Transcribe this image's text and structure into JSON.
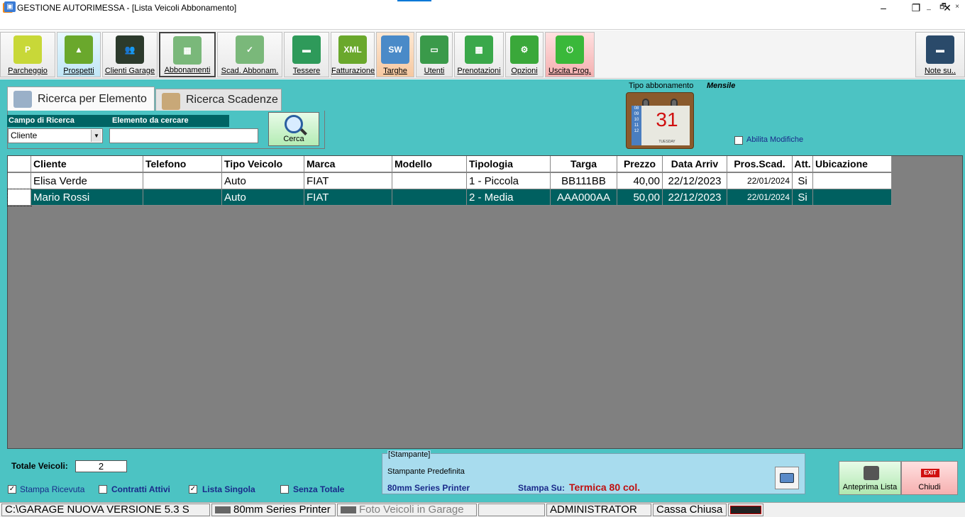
{
  "window": {
    "title": "GESTIONE AUTORIMESSA - [Lista Veicoli Abbonamento]",
    "app_icon_letter": "P",
    "minimize": "–",
    "restore": "❐",
    "close": "✕",
    "mdi_minimize": "_",
    "mdi_restore": "🗗",
    "mdi_close": "×"
  },
  "toolbar": [
    {
      "label": "Parcheggio",
      "icon": "parking-icon",
      "color": "#c8d838",
      "glyph": "P"
    },
    {
      "label": "Prospetti",
      "icon": "growth-chart-icon",
      "color": "#6aa82c",
      "glyph": "▲"
    },
    {
      "label": "Clienti Garage",
      "icon": "people-icon",
      "color": "#2c3a2c",
      "glyph": "👥"
    },
    {
      "label": "Abbonamenti",
      "icon": "calendar-icon",
      "color": "#7ab87a",
      "glyph": "▦"
    },
    {
      "label": "Scad. Abbonam.",
      "icon": "calendar-check-icon",
      "color": "#7ab87a",
      "glyph": "✓"
    },
    {
      "label": "Tessere",
      "icon": "card-icon",
      "color": "#2e9a5a",
      "glyph": "▬"
    },
    {
      "label": "Fatturazione",
      "icon": "xml-icon",
      "color": "#6aa82c",
      "glyph": "XML"
    },
    {
      "label": "Targhe",
      "icon": "plates-icon",
      "color": "#4a8ac8",
      "glyph": "SW"
    },
    {
      "label": "Utenti",
      "icon": "monitor-icon",
      "color": "#3a9a4a",
      "glyph": "▭"
    },
    {
      "label": "Prenotazioni",
      "icon": "booking-calendar-icon",
      "color": "#3aa84a",
      "glyph": "▦"
    },
    {
      "label": "Opzioni",
      "icon": "gear-icon",
      "color": "#3aa83a",
      "glyph": "⚙"
    },
    {
      "label": "Uscita Prog.",
      "icon": "power-icon",
      "color": "#3ab83a",
      "glyph": "⏻"
    },
    {
      "label": "Note su..",
      "icon": "garage-photo-icon",
      "color": "#2a4a6a",
      "glyph": "▬"
    }
  ],
  "tabs": [
    {
      "label": "Ricerca per Elemento",
      "icon": "search-add-icon"
    },
    {
      "label": "Ricerca Scadenze",
      "icon": "calendar-search-icon"
    }
  ],
  "search": {
    "campo_label": "Campo di Ricerca",
    "elemento_label": "Elemento da cercare",
    "campo_value": "Cliente",
    "elemento_value": "",
    "cerca_label": "Cerca"
  },
  "tipo_abbonamento": {
    "label": "Tipo abbonamento",
    "value": "Mensile",
    "calendar_day": "31",
    "calendar_side": "08\n09\n10\n11\n12",
    "calendar_footer": "TUESDAY"
  },
  "abilita_modifiche": {
    "label": "Abilita Modifiche",
    "checked": false
  },
  "grid": {
    "columns": [
      "Cliente",
      "Telefono",
      "Tipo Veicolo",
      "Marca",
      "Modello",
      "Tipologia",
      "Targa",
      "Prezzo",
      "Data Arriv",
      "Pros.Scad.",
      "Att.",
      "Ubicazione"
    ],
    "rows": [
      [
        "Elisa Verde",
        "",
        "Auto",
        "FIAT",
        "",
        "1 - Piccola",
        "BB111BB",
        "40,00",
        "22/12/2023",
        "22/01/2024",
        "Si",
        ""
      ],
      [
        "Mario Rossi",
        "",
        "Auto",
        "FIAT",
        "",
        "2 - Media",
        "AAA000AA",
        "50,00",
        "22/12/2023",
        "22/01/2024",
        "Si",
        ""
      ]
    ],
    "selected_row": 1
  },
  "footer": {
    "totale_label": "Totale Veicoli:",
    "totale_value": "2",
    "checkboxes": [
      {
        "label": "Stampa Ricevuta",
        "checked": true,
        "bold": false
      },
      {
        "label": "Contratti Attivi",
        "checked": false,
        "bold": true
      },
      {
        "label": "Lista Singola",
        "checked": true,
        "bold": true
      },
      {
        "label": "Senza Totale",
        "checked": false,
        "bold": true
      }
    ],
    "printer": {
      "legend": "[Stampante]",
      "default_label": "Stampante Predefinita",
      "name": "80mm Series Printer",
      "stampa_su_label": "Stampa Su:",
      "stampa_su_value": "Termica 80 col."
    },
    "anteprima_label": "Anteprima Lista",
    "chiudi_label": "Chiudi",
    "chiudi_icon_text": "EXIT"
  },
  "statusbar": {
    "path": "C:\\GARAGE NUOVA VERSIONE 5.3 S",
    "printer": "80mm Series Printer",
    "foto": "Foto Veicoli in Garage",
    "empty": "",
    "user": "ADMINISTRATOR",
    "cassa": "Cassa Chiusa"
  },
  "colors": {
    "panel": "#4cc3c3",
    "selected_row": "#006060",
    "header_label": "#006464",
    "grid_background": "#808080"
  }
}
